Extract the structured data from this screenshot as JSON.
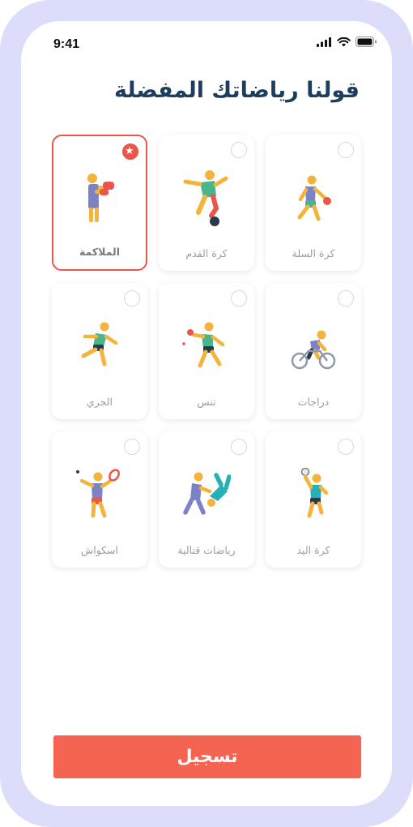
{
  "status_bar": {
    "time": "9:41"
  },
  "title": "قولنا رياضاتك المفضلة",
  "sports": [
    {
      "label": "الملاكمة",
      "icon": "boxing-icon",
      "selected": true
    },
    {
      "label": "كرة القدم",
      "icon": "soccer-icon",
      "selected": false
    },
    {
      "label": "كرة السلة",
      "icon": "basketball-icon",
      "selected": false
    },
    {
      "label": "الجري",
      "icon": "running-icon",
      "selected": false
    },
    {
      "label": "تنس",
      "icon": "tennis-icon",
      "selected": false
    },
    {
      "label": "دراجات",
      "icon": "cycling-icon",
      "selected": false
    },
    {
      "label": "اسكواش",
      "icon": "squash-icon",
      "selected": false
    },
    {
      "label": "رياضات قتالية",
      "icon": "martial-arts-icon",
      "selected": false
    },
    {
      "label": "كرة اليد",
      "icon": "handball-icon",
      "selected": false
    }
  ],
  "submit_label": "تسجيل",
  "colors": {
    "accent": "#f56351",
    "title": "#1d3d5e",
    "frame": "#dcdcfb"
  }
}
